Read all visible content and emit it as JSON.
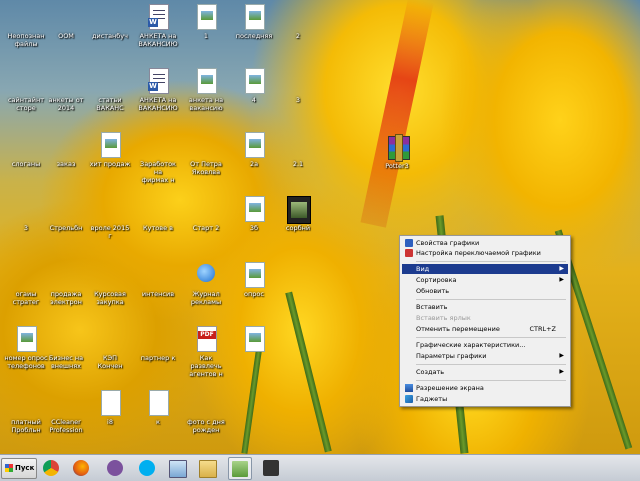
{
  "desktop": {
    "icons": [
      {
        "label": "Неопознан\nфайлы",
        "type": "folder"
      },
      {
        "label": "ООМ",
        "type": "folder"
      },
      {
        "label": "дистанбуч",
        "type": "folder"
      },
      {
        "label": "АНКЕТА на\nВАКАНСИЮ",
        "type": "word"
      },
      {
        "label": "1",
        "type": "image"
      },
      {
        "label": "последняя",
        "type": "image"
      },
      {
        "label": "2",
        "type": "folder"
      },
      {
        "label": "сайнтайнт\nсторе",
        "type": "folder"
      },
      {
        "label": "анкеты от\n2014",
        "type": "folder"
      },
      {
        "label": "статьи\nВАКАНС",
        "type": "folder"
      },
      {
        "label": "АНКЕТА на\nВАКАНСИЮ",
        "type": "word"
      },
      {
        "label": "анкета на\nвакансию",
        "type": "image"
      },
      {
        "label": "4",
        "type": "image"
      },
      {
        "label": "3",
        "type": "folder"
      },
      {
        "label": "слоганы",
        "type": "folder"
      },
      {
        "label": "заказ",
        "type": "folder"
      },
      {
        "label": "хит продаж",
        "type": "image"
      },
      {
        "label": "Заработок на\nфирмах н",
        "type": "folder"
      },
      {
        "label": "От Петра\nЯковлва",
        "type": "folder"
      },
      {
        "label": "2а",
        "type": "image"
      },
      {
        "label": "2.1",
        "type": "folder"
      },
      {
        "label": "3",
        "type": "folder"
      },
      {
        "label": "Стрельбн",
        "type": "folder"
      },
      {
        "label": "вроле 2015 г",
        "type": "folder"
      },
      {
        "label": "Кутове в",
        "type": "folder"
      },
      {
        "label": "Старт 2",
        "type": "folder"
      },
      {
        "label": "3б",
        "type": "image"
      },
      {
        "label": "сорбнй",
        "type": "video"
      },
      {
        "label": "огаиы\nстратег",
        "type": "folder"
      },
      {
        "label": "продажа\nэлектрон",
        "type": "folder"
      },
      {
        "label": "Курсовая\nзакупка",
        "type": "folder"
      },
      {
        "label": "интенсив",
        "type": "folder"
      },
      {
        "label": "Журнал\nрекламы",
        "type": "ie"
      },
      {
        "label": "опрос",
        "type": "image"
      },
      {
        "label": "номер опрос\nтелефонов",
        "type": "image"
      },
      {
        "label": "Бизнес на\nвнешнях",
        "type": "folder"
      },
      {
        "label": "КЭП\nКончен",
        "type": "folder"
      },
      {
        "label": "партнер к",
        "type": "folder"
      },
      {
        "label": "Как развлечь\nагентов н",
        "type": "pdf"
      },
      {
        "label": "",
        "type": "image"
      },
      {
        "label": "платный\nПробльн",
        "type": "folder"
      },
      {
        "label": "CCleaner\nProfession",
        "type": "folder"
      },
      {
        "label": "i8",
        "type": "doc"
      },
      {
        "label": "к",
        "type": "doc"
      },
      {
        "label": "фото с дня\nрожден",
        "type": "folder"
      },
      {
        "label": "",
        "type": "folder"
      }
    ],
    "archive": {
      "label": "Potter3"
    },
    "video_label": "сорбнй"
  },
  "context_menu": {
    "items": [
      {
        "label": "Свойства графики",
        "icon": "intel-graphics-icon",
        "state": "normal"
      },
      {
        "label": "Настройка переключаемой графики",
        "icon": "switchable-graphics-icon",
        "state": "normal"
      },
      {
        "label": "Вид",
        "state": "highlighted",
        "submenu": true
      },
      {
        "label": "Сортировка",
        "state": "normal",
        "submenu": true
      },
      {
        "label": "Обновить",
        "state": "normal"
      },
      {
        "label": "Вставить",
        "state": "normal"
      },
      {
        "label": "Вставить ярлык",
        "state": "disabled"
      },
      {
        "label": "Отменить перемещение",
        "shortcut": "CTRL+Z",
        "state": "normal"
      },
      {
        "label": "Графические характеристики...",
        "state": "normal"
      },
      {
        "label": "Параметры графики",
        "state": "normal",
        "submenu": true
      },
      {
        "label": "Создать",
        "state": "normal",
        "submenu": true
      },
      {
        "label": "Разрешение экрана",
        "icon": "display-icon",
        "state": "normal"
      },
      {
        "label": "Гаджеты",
        "icon": "gadgets-icon",
        "state": "normal"
      }
    ]
  },
  "taskbar": {
    "start_label": "Пуск",
    "apps": [
      "chrome-icon",
      "firefox-icon",
      "viber-icon",
      "skype-icon",
      "picture-viewer-icon",
      "folder-icon",
      "image-app-icon",
      "camera-app-icon"
    ]
  },
  "colors": {
    "menu_highlight": "#1c3b8f",
    "taskbar": "#d6dae0"
  }
}
